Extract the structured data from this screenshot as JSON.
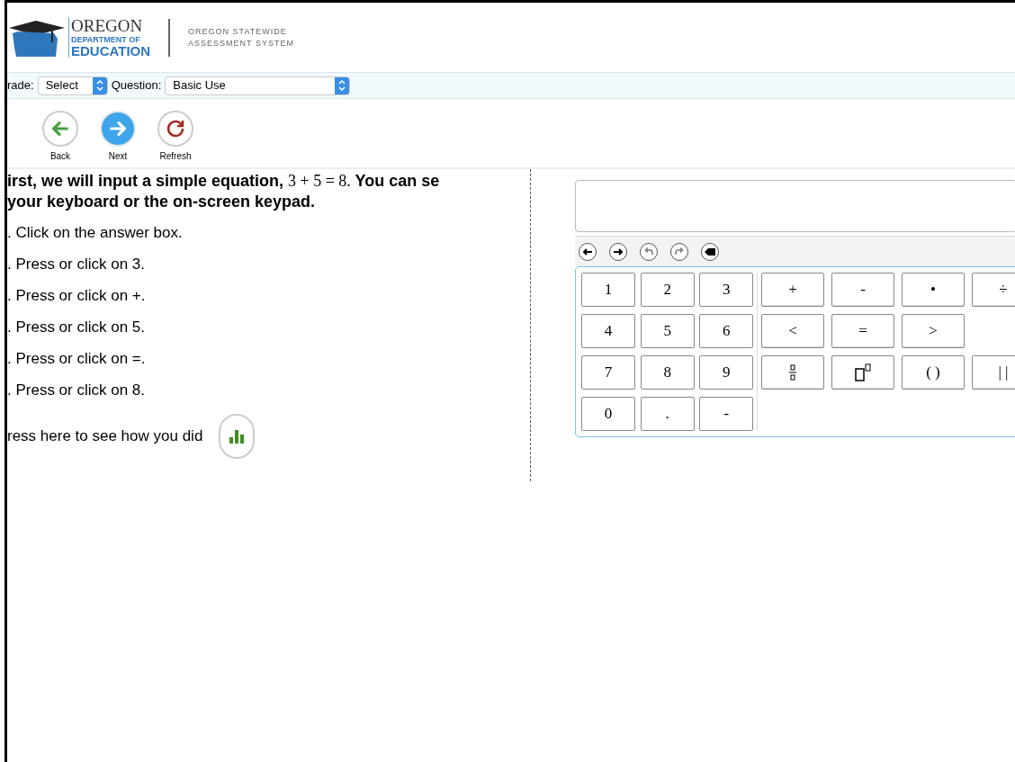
{
  "header": {
    "logo_title": "OREGON",
    "logo_sub1": "DEPARTMENT OF",
    "logo_sub2": "EDUCATION",
    "system_line1": "OREGON STATEWIDE",
    "system_line2": "ASSESSMENT SYSTEM"
  },
  "selectors": [
    {
      "label": "rade:",
      "value": "Select"
    },
    {
      "label": "Question:",
      "value": "Basic Use"
    }
  ],
  "nav_buttons": [
    {
      "kind": "back",
      "label": "Back"
    },
    {
      "kind": "next",
      "label": "Next"
    },
    {
      "kind": "refresh",
      "label": "Refresh"
    }
  ],
  "intro": {
    "before": "irst, we will input a simple equation,",
    "math": "3 + 5 = 8.",
    "after": "You can se your keyboard or the on-screen keypad."
  },
  "steps": [
    ". Click on the answer box.",
    ". Press or click on 3.",
    ". Press or click on +.",
    ". Press or click on 5.",
    ". Press or click on =.",
    ". Press or click on 8."
  ],
  "score_prompt": "ress here to see how you did",
  "edit_tools": [
    {
      "kind": "left"
    },
    {
      "kind": "right"
    },
    {
      "kind": "undo"
    },
    {
      "kind": "redo"
    },
    {
      "kind": "delete"
    }
  ],
  "number_keys": [
    "1",
    "2",
    "3",
    "4",
    "5",
    "6",
    "7",
    "8",
    "9",
    "0",
    ".",
    "-"
  ],
  "operator_rows": [
    [
      {
        "kind": "text",
        "label": "+"
      },
      {
        "kind": "text",
        "label": "-"
      },
      {
        "kind": "text",
        "label": "•"
      },
      {
        "kind": "text",
        "label": "÷"
      }
    ],
    [
      {
        "kind": "text",
        "label": "<"
      },
      {
        "kind": "text",
        "label": "="
      },
      {
        "kind": "text",
        "label": ">"
      },
      {
        "kind": "blank"
      }
    ],
    [
      {
        "kind": "fraction"
      },
      {
        "kind": "power"
      },
      {
        "kind": "text",
        "label": "( )"
      },
      {
        "kind": "text",
        "label": "| |"
      }
    ]
  ]
}
